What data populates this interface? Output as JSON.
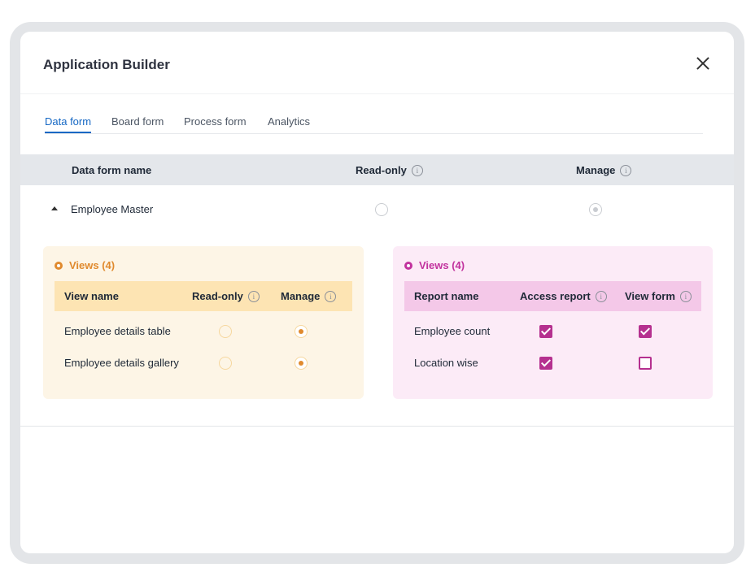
{
  "modal": {
    "title": "Application Builder"
  },
  "tabs": [
    {
      "label": "Data form",
      "active": true
    },
    {
      "label": "Board form",
      "active": false
    },
    {
      "label": "Process form",
      "active": false
    },
    {
      "label": "Analytics",
      "active": false
    }
  ],
  "table": {
    "headers": {
      "name": "Data form name",
      "readonly": "Read-only",
      "manage": "Manage"
    },
    "rows": [
      {
        "name": "Employee Master",
        "expanded": true,
        "readonly_selected": false,
        "manage_selected": true
      }
    ]
  },
  "views_panel": {
    "title": "Views (4)",
    "headers": {
      "name": "View name",
      "readonly": "Read-only",
      "manage": "Manage"
    },
    "rows": [
      {
        "name": "Employee details table",
        "readonly": false,
        "manage": true
      },
      {
        "name": "Employee details gallery",
        "readonly": false,
        "manage": true
      }
    ]
  },
  "reports_panel": {
    "title": "Views (4)",
    "headers": {
      "name": "Report name",
      "access": "Access report",
      "view": "View form"
    },
    "rows": [
      {
        "name": "Employee count",
        "access": true,
        "view": true
      },
      {
        "name": "Location wise",
        "access": true,
        "view": false
      }
    ]
  },
  "icons": {
    "close": "close-icon",
    "info": "info-icon",
    "eye": "eye-icon",
    "caret": "caret-up-icon"
  },
  "colors": {
    "accent_blue": "#1668c4",
    "orange": "#e08a2e",
    "magenta": "#b5308f"
  }
}
